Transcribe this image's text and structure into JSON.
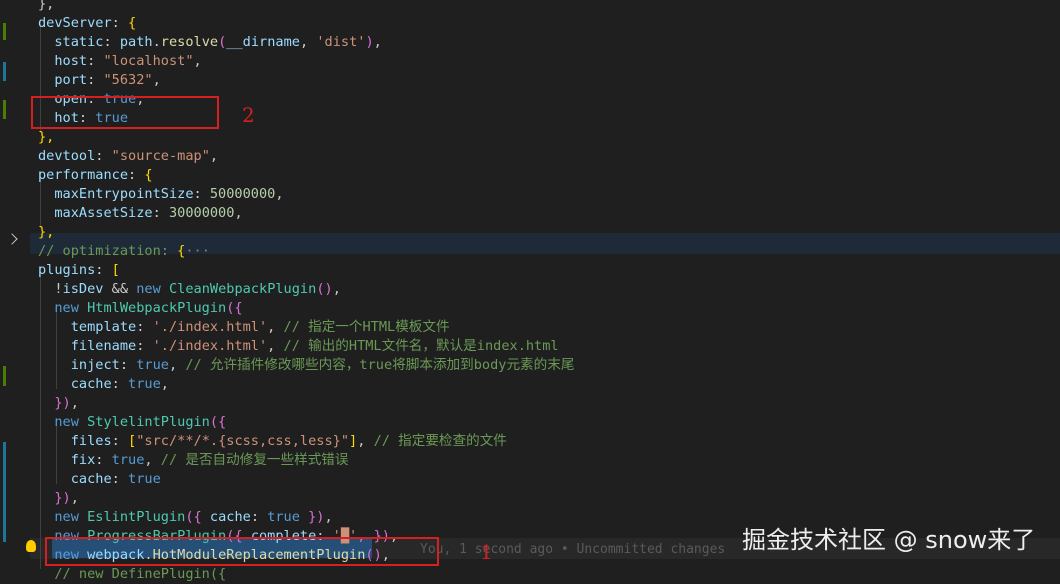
{
  "lines": [
    [
      {
        "t": "},",
        "c": "p"
      }
    ],
    [
      {
        "t": "devServer",
        "c": "v"
      },
      {
        "t": ": ",
        "c": "p"
      },
      {
        "t": "{",
        "c": "y"
      }
    ],
    [
      {
        "t": "  static",
        "c": "v"
      },
      {
        "t": ": ",
        "c": "p"
      },
      {
        "t": "path",
        "c": "v"
      },
      {
        "t": ".",
        "c": "p"
      },
      {
        "t": "resolve",
        "c": "f"
      },
      {
        "t": "(",
        "c": "m"
      },
      {
        "t": "__dirname",
        "c": "v"
      },
      {
        "t": ", ",
        "c": "p"
      },
      {
        "t": "'dist'",
        "c": "s"
      },
      {
        "t": ")",
        "c": "m"
      },
      {
        "t": ",",
        "c": "p"
      }
    ],
    [
      {
        "t": "  host",
        "c": "v"
      },
      {
        "t": ": ",
        "c": "p"
      },
      {
        "t": "\"localhost\"",
        "c": "s"
      },
      {
        "t": ",",
        "c": "p"
      }
    ],
    [
      {
        "t": "  port",
        "c": "v"
      },
      {
        "t": ": ",
        "c": "p"
      },
      {
        "t": "\"5632\"",
        "c": "s"
      },
      {
        "t": ",",
        "c": "p"
      }
    ],
    [
      {
        "t": "  open",
        "c": "v"
      },
      {
        "t": ": ",
        "c": "p"
      },
      {
        "t": "true",
        "c": "k"
      },
      {
        "t": ",",
        "c": "p"
      }
    ],
    [
      {
        "t": "  hot",
        "c": "v"
      },
      {
        "t": ": ",
        "c": "p"
      },
      {
        "t": "true",
        "c": "k"
      }
    ],
    [
      {
        "t": "},",
        "c": "y"
      }
    ],
    [
      {
        "t": "devtool",
        "c": "v"
      },
      {
        "t": ": ",
        "c": "p"
      },
      {
        "t": "\"source-map\"",
        "c": "s"
      },
      {
        "t": ",",
        "c": "p"
      }
    ],
    [
      {
        "t": "performance",
        "c": "v"
      },
      {
        "t": ": ",
        "c": "p"
      },
      {
        "t": "{",
        "c": "y"
      }
    ],
    [
      {
        "t": "  maxEntrypointSize",
        "c": "v"
      },
      {
        "t": ": ",
        "c": "p"
      },
      {
        "t": "50000000",
        "c": "n"
      },
      {
        "t": ",",
        "c": "p"
      }
    ],
    [
      {
        "t": "  maxAssetSize",
        "c": "v"
      },
      {
        "t": ": ",
        "c": "p"
      },
      {
        "t": "30000000",
        "c": "n"
      },
      {
        "t": ",",
        "c": "p"
      }
    ],
    [
      {
        "t": "},",
        "c": "y"
      }
    ],
    [
      {
        "t": "// optimization: ",
        "c": "c"
      },
      {
        "t": "{",
        "c": "y"
      },
      {
        "t": "···",
        "c": "dim"
      }
    ],
    [
      {
        "t": "plugins",
        "c": "v"
      },
      {
        "t": ": ",
        "c": "p"
      },
      {
        "t": "[",
        "c": "y"
      }
    ],
    [
      {
        "t": "  !",
        "c": "p"
      },
      {
        "t": "isDev",
        "c": "v"
      },
      {
        "t": " && ",
        "c": "p"
      },
      {
        "t": "new ",
        "c": "k"
      },
      {
        "t": "CleanWebpackPlugin",
        "c": "t"
      },
      {
        "t": "()",
        "c": "m"
      },
      {
        "t": ",",
        "c": "p"
      }
    ],
    [
      {
        "t": "  new ",
        "c": "k"
      },
      {
        "t": "HtmlWebpackPlugin",
        "c": "t"
      },
      {
        "t": "({",
        "c": "m"
      }
    ],
    [
      {
        "t": "    template",
        "c": "v"
      },
      {
        "t": ": ",
        "c": "p"
      },
      {
        "t": "'./index.html'",
        "c": "s"
      },
      {
        "t": ", ",
        "c": "p"
      },
      {
        "t": "// 指定一个HTML模板文件",
        "c": "c"
      }
    ],
    [
      {
        "t": "    filename",
        "c": "v"
      },
      {
        "t": ": ",
        "c": "p"
      },
      {
        "t": "'./index.html'",
        "c": "s"
      },
      {
        "t": ", ",
        "c": "p"
      },
      {
        "t": "// 输出的HTML文件名，默认是index.html",
        "c": "c"
      }
    ],
    [
      {
        "t": "    inject",
        "c": "v"
      },
      {
        "t": ": ",
        "c": "p"
      },
      {
        "t": "true",
        "c": "k"
      },
      {
        "t": ", ",
        "c": "p"
      },
      {
        "t": "// 允许插件修改哪些内容，true将脚本添加到body元素的末尾",
        "c": "c"
      }
    ],
    [
      {
        "t": "    cache",
        "c": "v"
      },
      {
        "t": ": ",
        "c": "p"
      },
      {
        "t": "true",
        "c": "k"
      },
      {
        "t": ",",
        "c": "p"
      }
    ],
    [
      {
        "t": "  })",
        "c": "m"
      },
      {
        "t": ",",
        "c": "p"
      }
    ],
    [
      {
        "t": "  new ",
        "c": "k"
      },
      {
        "t": "StylelintPlugin",
        "c": "t"
      },
      {
        "t": "({",
        "c": "m"
      }
    ],
    [
      {
        "t": "    files",
        "c": "v"
      },
      {
        "t": ": ",
        "c": "p"
      },
      {
        "t": "[",
        "c": "y"
      },
      {
        "t": "\"src/**/*.{scss,css,less}\"",
        "c": "s"
      },
      {
        "t": "]",
        "c": "y"
      },
      {
        "t": ", ",
        "c": "p"
      },
      {
        "t": "// 指定要检查的文件",
        "c": "c"
      }
    ],
    [
      {
        "t": "    fix",
        "c": "v"
      },
      {
        "t": ": ",
        "c": "p"
      },
      {
        "t": "true",
        "c": "k"
      },
      {
        "t": ", ",
        "c": "p"
      },
      {
        "t": "// 是否自动修复一些样式错误",
        "c": "c"
      }
    ],
    [
      {
        "t": "    cache",
        "c": "v"
      },
      {
        "t": ": ",
        "c": "p"
      },
      {
        "t": "true",
        "c": "k"
      }
    ],
    [
      {
        "t": "  })",
        "c": "m"
      },
      {
        "t": ",",
        "c": "p"
      }
    ],
    [
      {
        "t": "  new ",
        "c": "k"
      },
      {
        "t": "EslintPlugin",
        "c": "t"
      },
      {
        "t": "({ ",
        "c": "m"
      },
      {
        "t": "cache",
        "c": "v"
      },
      {
        "t": ": ",
        "c": "p"
      },
      {
        "t": "true",
        "c": "k"
      },
      {
        "t": " })",
        "c": "m"
      },
      {
        "t": ",",
        "c": "p"
      }
    ],
    [
      {
        "t": "  new ",
        "c": "k"
      },
      {
        "t": "ProgressBarPlugin",
        "c": "t"
      },
      {
        "t": "({ ",
        "c": "m"
      },
      {
        "t": "complete",
        "c": "v"
      },
      {
        "t": ": ",
        "c": "p"
      },
      {
        "t": "'",
        "c": "s"
      },
      {
        "t": "█",
        "c": "s"
      },
      {
        "t": "'",
        "c": "s"
      },
      {
        "t": ", })",
        "c": "m"
      },
      {
        "t": ",",
        "c": "p"
      }
    ],
    [
      {
        "t": "  new ",
        "c": "k"
      },
      {
        "t": "webpack",
        "c": "v"
      },
      {
        "t": ".",
        "c": "p"
      },
      {
        "t": "HotModuleReplacementPlugin",
        "c": "f"
      },
      {
        "t": "()",
        "c": "m"
      },
      {
        "t": ",",
        "c": "p"
      }
    ],
    [
      {
        "t": "  // new DefinePlugin({",
        "c": "c"
      }
    ]
  ],
  "blame": "You, 1 second ago • Uncommitted changes",
  "annotations": {
    "one": "1",
    "two": "2"
  },
  "watermark": "掘金技术社区 @ snow来了",
  "icons": {
    "fold": "chevron-right-icon",
    "lightbulb": "lightbulb-icon"
  },
  "colors": {
    "background": "#1f1f1f",
    "keyword": "#569cd6",
    "string": "#ce9178",
    "comment": "#6a9955",
    "highlight_box": "#d42020"
  }
}
